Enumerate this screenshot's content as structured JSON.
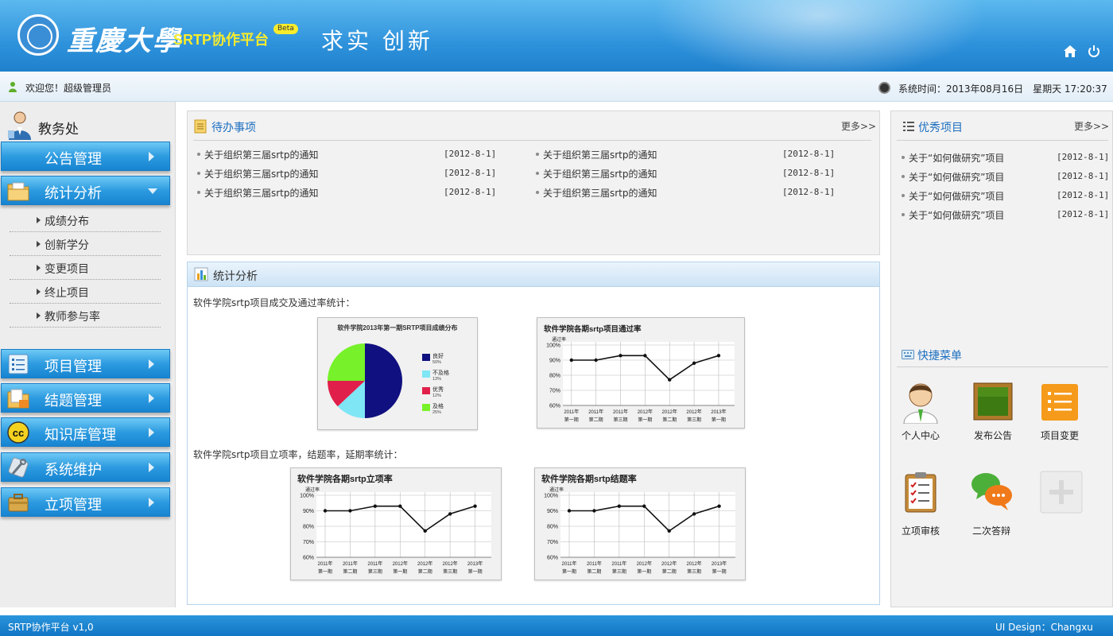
{
  "header": {
    "university": "重慶大學",
    "platform": "SRTP协作平台",
    "beta": "Beta",
    "motto": "求实 创新",
    "icons": [
      "home-icon",
      "power-icon"
    ]
  },
  "subbar": {
    "welcome": "欢迎您！超级管理员",
    "time": "系统时间：2013年08月16日　星期天 17:20:37"
  },
  "sidebar": {
    "department": "教务处",
    "menus": [
      {
        "label": "公告管理",
        "expanded": false
      },
      {
        "label": "统计分析",
        "expanded": true,
        "icon": "folder-icon",
        "children": [
          "成绩分布",
          "创新学分",
          "变更项目",
          "终止项目",
          "教师参与率"
        ]
      },
      {
        "label": "项目管理",
        "icon": "list-icon"
      },
      {
        "label": "结题管理",
        "icon": "folder-icon"
      },
      {
        "label": "知识库管理",
        "icon": "cc-icon"
      },
      {
        "label": "系统维护",
        "icon": "tools-icon"
      },
      {
        "label": "立项管理",
        "icon": "briefcase-icon"
      }
    ]
  },
  "todo": {
    "title": "待办事项",
    "more": "更多>>",
    "items": [
      {
        "text": "关于组织第三届srtp的通知",
        "date": "[2012-8-1]"
      },
      {
        "text": "关于组织第三届srtp的通知",
        "date": "[2012-8-1]"
      },
      {
        "text": "关于组织第三届srtp的通知",
        "date": "[2012-8-1]"
      },
      {
        "text": "关于组织第三届srtp的通知",
        "date": "[2012-8-1]"
      },
      {
        "text": "关于组织第三届srtp的通知",
        "date": "[2012-8-1]"
      },
      {
        "text": "关于组织第三届srtp的通知",
        "date": "[2012-8-1]"
      }
    ]
  },
  "excellent": {
    "title": "优秀项目",
    "more": "更多>>",
    "items": [
      {
        "text": "关于“如何做研究”项目",
        "date": "[2012-8-1]"
      },
      {
        "text": "关于“如何做研究”项目",
        "date": "[2012-8-1]"
      },
      {
        "text": "关于“如何做研究”项目",
        "date": "[2012-8-1]"
      },
      {
        "text": "关于“如何做研究”项目",
        "date": "[2012-8-1]"
      }
    ]
  },
  "stats": {
    "title": "统计分析",
    "caption1": "软件学院srtp项目成交及通过率统计：",
    "caption2": "软件学院srtp项目立项率，结题率，延期率统计："
  },
  "chart_data": [
    {
      "type": "pie",
      "title": "软件学院2013年第一期SRTP项目成绩分布",
      "slices": [
        {
          "label": "良好",
          "value": 50,
          "pct": "50%",
          "color": "#101080"
        },
        {
          "label": "不及格",
          "value": 13,
          "pct": "13%",
          "color": "#7fe6f5"
        },
        {
          "label": "优秀",
          "value": 12,
          "pct": "12%",
          "color": "#e0204a"
        },
        {
          "label": "及格",
          "value": 25,
          "pct": "25%",
          "color": "#77f22a"
        }
      ]
    },
    {
      "type": "line",
      "title": "软件学院各期srtp项目通过率",
      "ylabel": "通过率",
      "categories": [
        "2011年第一期",
        "2011年第二期",
        "2011年第三期",
        "2012年第一期",
        "2012年第二期",
        "2012年第三期",
        "2013年第一期"
      ],
      "cat_top": [
        "2011年",
        "2011年",
        "2011年",
        "2012年",
        "2012年",
        "2012年",
        "2013年"
      ],
      "cat_bottom": [
        "第一期",
        "第二期",
        "第三期",
        "第一期",
        "第二期",
        "第三期",
        "第一期"
      ],
      "yticks": [
        "100%",
        "90%",
        "80%",
        "70%",
        "60%"
      ],
      "ylim": [
        60,
        100
      ],
      "values": [
        90,
        90,
        93,
        93,
        77,
        88,
        93
      ]
    },
    {
      "type": "line",
      "title": "软件学院各期srtp立项率",
      "ylabel": "通过率",
      "categories": [
        "2011年第一期",
        "2011年第二期",
        "2011年第三期",
        "2012年第一期",
        "2012年第二期",
        "2012年第三期",
        "2013年第一期"
      ],
      "cat_top": [
        "2011年",
        "2011年",
        "2011年",
        "2012年",
        "2012年",
        "2012年",
        "2013年"
      ],
      "cat_bottom": [
        "第一期",
        "第二期",
        "第三期",
        "第一期",
        "第二期",
        "第三期",
        "第一期"
      ],
      "yticks": [
        "100%",
        "90%",
        "80%",
        "70%",
        "60%"
      ],
      "ylim": [
        60,
        100
      ],
      "values": [
        90,
        90,
        93,
        93,
        77,
        88,
        93
      ]
    },
    {
      "type": "line",
      "title": "软件学院各期srtp结题率",
      "ylabel": "通过率",
      "categories": [
        "2011年第一期",
        "2011年第二期",
        "2011年第三期",
        "2012年第一期",
        "2012年第二期",
        "2012年第三期",
        "2013年第一期"
      ],
      "cat_top": [
        "2011年",
        "2011年",
        "2011年",
        "2012年",
        "2012年",
        "2012年",
        "2013年"
      ],
      "cat_bottom": [
        "第一期",
        "第二期",
        "第三期",
        "第一期",
        "第二期",
        "第三期",
        "第一期"
      ],
      "yticks": [
        "100%",
        "90%",
        "80%",
        "70%",
        "60%"
      ],
      "ylim": [
        60,
        100
      ],
      "values": [
        90,
        90,
        93,
        93,
        77,
        88,
        93
      ]
    }
  ],
  "quick_menu": {
    "title": "快捷菜单",
    "items": [
      {
        "label": "个人中心",
        "icon": "user-center-icon"
      },
      {
        "label": "发布公告",
        "icon": "blackboard-icon"
      },
      {
        "label": "项目变更",
        "icon": "list-change-icon"
      },
      {
        "label": "立项审核",
        "icon": "clipboard-icon"
      },
      {
        "label": "二次答辩",
        "icon": "chat-bubbles-icon"
      },
      {
        "label": "",
        "icon": "add-icon"
      }
    ]
  },
  "footer": {
    "left": "SRTP协作平台 v1,0",
    "right": "UI Design：Changxu"
  }
}
